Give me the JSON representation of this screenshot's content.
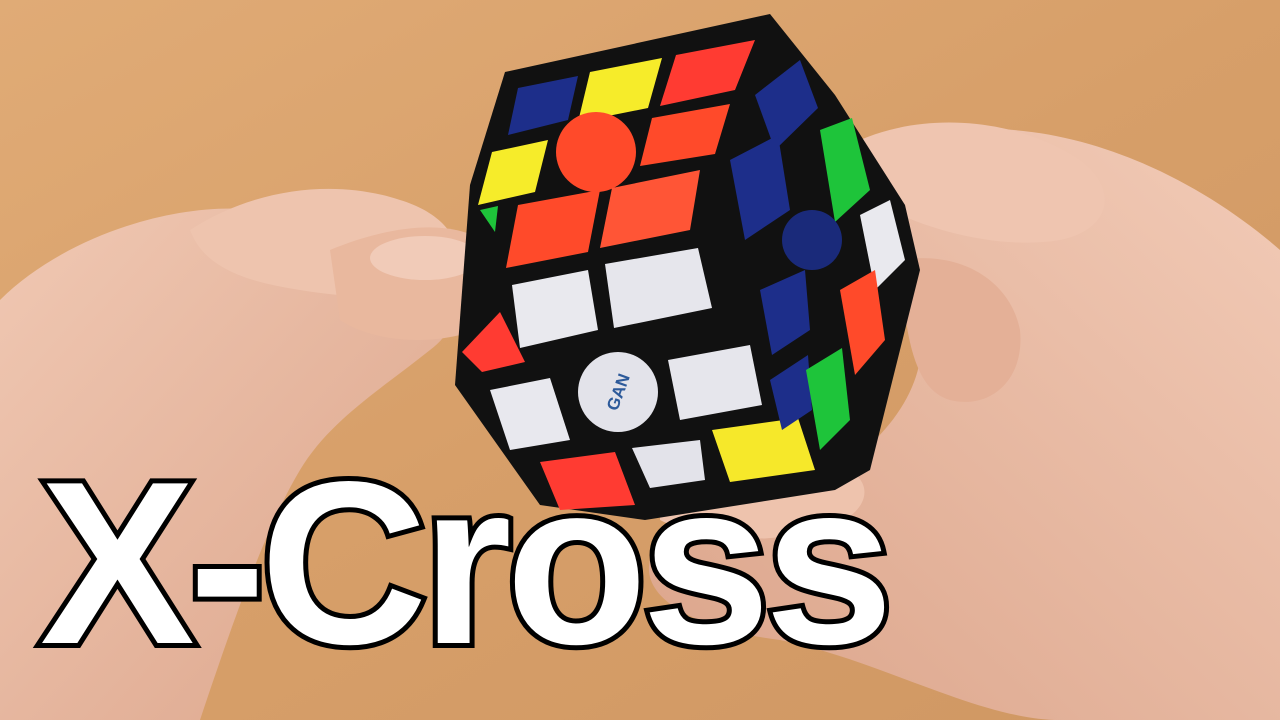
{
  "caption": {
    "text": "X-Cross"
  },
  "logo": {
    "text": "GAN"
  },
  "colors": {
    "table": "#d9a36e",
    "cube_body": "#111111",
    "white": "#e9e9ee",
    "yellow": "#f6ec2a",
    "red": "#ff4a2a",
    "orange": "#ff6a3a",
    "blue": "#1d2e8a",
    "green": "#1ec43a",
    "skin": "#e8b9a0",
    "caption_fill": "#ffffff",
    "caption_stroke": "#000000"
  },
  "icons": [
    "rubiks-cube",
    "hand-left",
    "hand-right"
  ]
}
